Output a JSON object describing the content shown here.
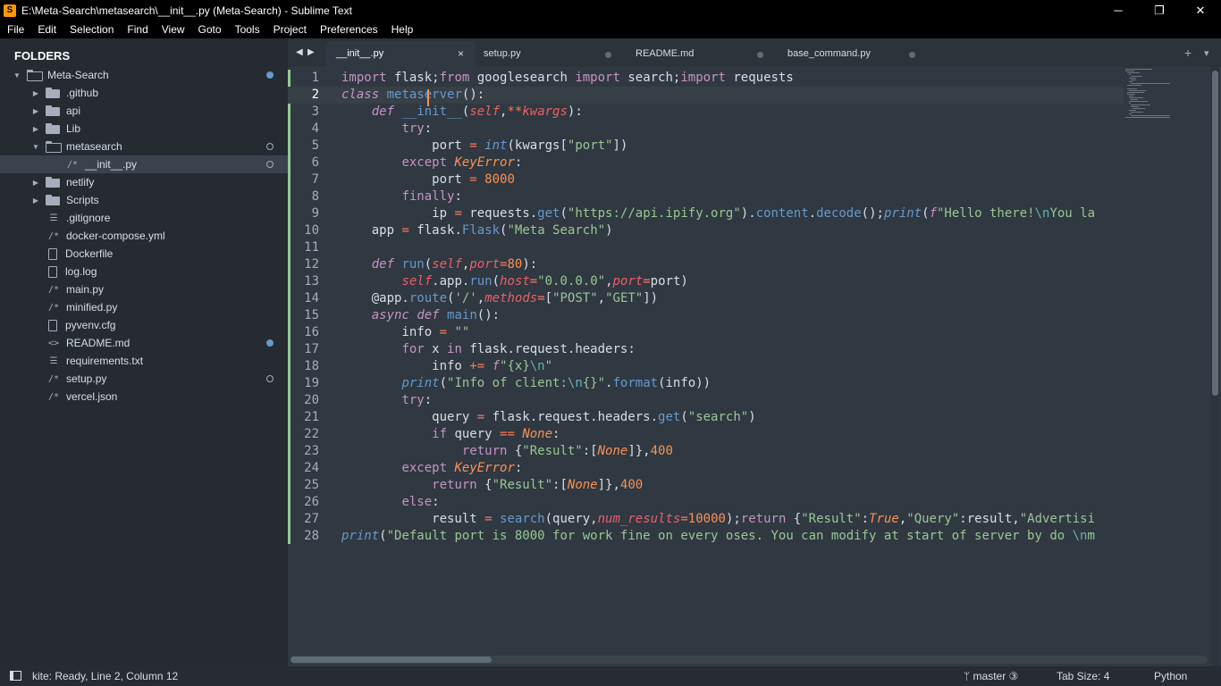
{
  "window": {
    "title": "E:\\Meta-Search\\metasearch\\__init__.py (Meta-Search) - Sublime Text",
    "minimize": "─",
    "maximize": "❐",
    "close": "✕"
  },
  "menu": [
    "File",
    "Edit",
    "Selection",
    "Find",
    "View",
    "Goto",
    "Tools",
    "Project",
    "Preferences",
    "Help"
  ],
  "sidebar": {
    "title": "FOLDERS",
    "items": [
      {
        "label": "Meta-Search",
        "type": "folder-open",
        "depth": 0,
        "dot": "filled"
      },
      {
        "label": ".github",
        "type": "folder",
        "depth": 1,
        "dot": ""
      },
      {
        "label": "api",
        "type": "folder",
        "depth": 1,
        "dot": ""
      },
      {
        "label": "Lib",
        "type": "folder",
        "depth": 1,
        "dot": ""
      },
      {
        "label": "metasearch",
        "type": "folder-open",
        "depth": 1,
        "dot": "hollow"
      },
      {
        "label": "__init__.py",
        "type": "py",
        "depth": 2,
        "dot": "hollow",
        "active": true
      },
      {
        "label": "netlify",
        "type": "folder",
        "depth": 1,
        "dot": ""
      },
      {
        "label": "Scripts",
        "type": "folder",
        "depth": 1,
        "dot": ""
      },
      {
        "label": ".gitignore",
        "type": "lines",
        "depth": 1,
        "dot": ""
      },
      {
        "label": "docker-compose.yml",
        "type": "py",
        "depth": 1,
        "dot": ""
      },
      {
        "label": "Dockerfile",
        "type": "doc",
        "depth": 1,
        "dot": ""
      },
      {
        "label": "log.log",
        "type": "doc",
        "depth": 1,
        "dot": ""
      },
      {
        "label": "main.py",
        "type": "py",
        "depth": 1,
        "dot": ""
      },
      {
        "label": "minified.py",
        "type": "py",
        "depth": 1,
        "dot": ""
      },
      {
        "label": "pyvenv.cfg",
        "type": "doc",
        "depth": 1,
        "dot": ""
      },
      {
        "label": "README.md",
        "type": "md",
        "depth": 1,
        "dot": "filled"
      },
      {
        "label": "requirements.txt",
        "type": "lines",
        "depth": 1,
        "dot": ""
      },
      {
        "label": "setup.py",
        "type": "py",
        "depth": 1,
        "dot": "hollow"
      },
      {
        "label": "vercel.json",
        "type": "py",
        "depth": 1,
        "dot": ""
      }
    ]
  },
  "tabs": [
    {
      "label": "__init__.py",
      "active": true
    },
    {
      "label": "setup.py",
      "active": false
    },
    {
      "label": "README.md",
      "active": false
    },
    {
      "label": "base_command.py",
      "active": false
    }
  ],
  "icons": {
    "nav_left": "◀",
    "nav_right": "▶",
    "new_tab": "+",
    "tab_menu": "▾",
    "tab_close": "×",
    "arrow_open": "▼",
    "arrow_closed": "▶",
    "py_glyph": "/*",
    "md_glyph": "<>",
    "lines_glyph": "☰"
  },
  "editor": {
    "current_line": 2,
    "lines": [
      [
        [
          "kw",
          "import"
        ],
        [
          "",
          "  flask"
        ],
        [
          "kw",
          ";"
        ],
        [
          "kw",
          "from"
        ],
        [
          "",
          " googlesearch "
        ],
        [
          "kw",
          "import"
        ],
        [
          "",
          " search"
        ],
        [
          "kw",
          ";"
        ],
        [
          "kw",
          "import"
        ],
        [
          "",
          " requests"
        ]
      ],
      [
        [
          "kwi",
          "class"
        ],
        [
          "",
          " "
        ],
        [
          "fn",
          "metaserver"
        ],
        [
          "",
          "():"
        ]
      ],
      [
        [
          "",
          ""
        ]
      ],
      [
        [
          "",
          ""
        ]
      ],
      [
        [
          "",
          ""
        ]
      ],
      [
        [
          "",
          ""
        ]
      ],
      [
        [
          "",
          ""
        ]
      ],
      [
        [
          "",
          ""
        ]
      ],
      [
        [
          "",
          ""
        ]
      ],
      [
        [
          "",
          ""
        ]
      ],
      [
        [
          "",
          ""
        ]
      ],
      [
        [
          "",
          ""
        ]
      ],
      [
        [
          "",
          ""
        ]
      ],
      [
        [
          "",
          ""
        ]
      ],
      [
        [
          "",
          ""
        ]
      ],
      [
        [
          "",
          ""
        ]
      ],
      [
        [
          "",
          ""
        ]
      ],
      [
        [
          "",
          ""
        ]
      ],
      [
        [
          "",
          ""
        ]
      ],
      [
        [
          "",
          ""
        ]
      ],
      [
        [
          "",
          ""
        ]
      ],
      [
        [
          "",
          ""
        ]
      ],
      [
        [
          "",
          ""
        ]
      ],
      [
        [
          "",
          ""
        ]
      ],
      [
        [
          "",
          ""
        ]
      ],
      [
        [
          "",
          ""
        ]
      ],
      [
        [
          "",
          ""
        ]
      ],
      [
        [
          "",
          ""
        ]
      ]
    ]
  },
  "status": {
    "text": "kite: Ready, Line 2, Column 12",
    "branch": "ᛘ master ③",
    "tab_size": "Tab Size: 4",
    "syntax": "Python"
  }
}
